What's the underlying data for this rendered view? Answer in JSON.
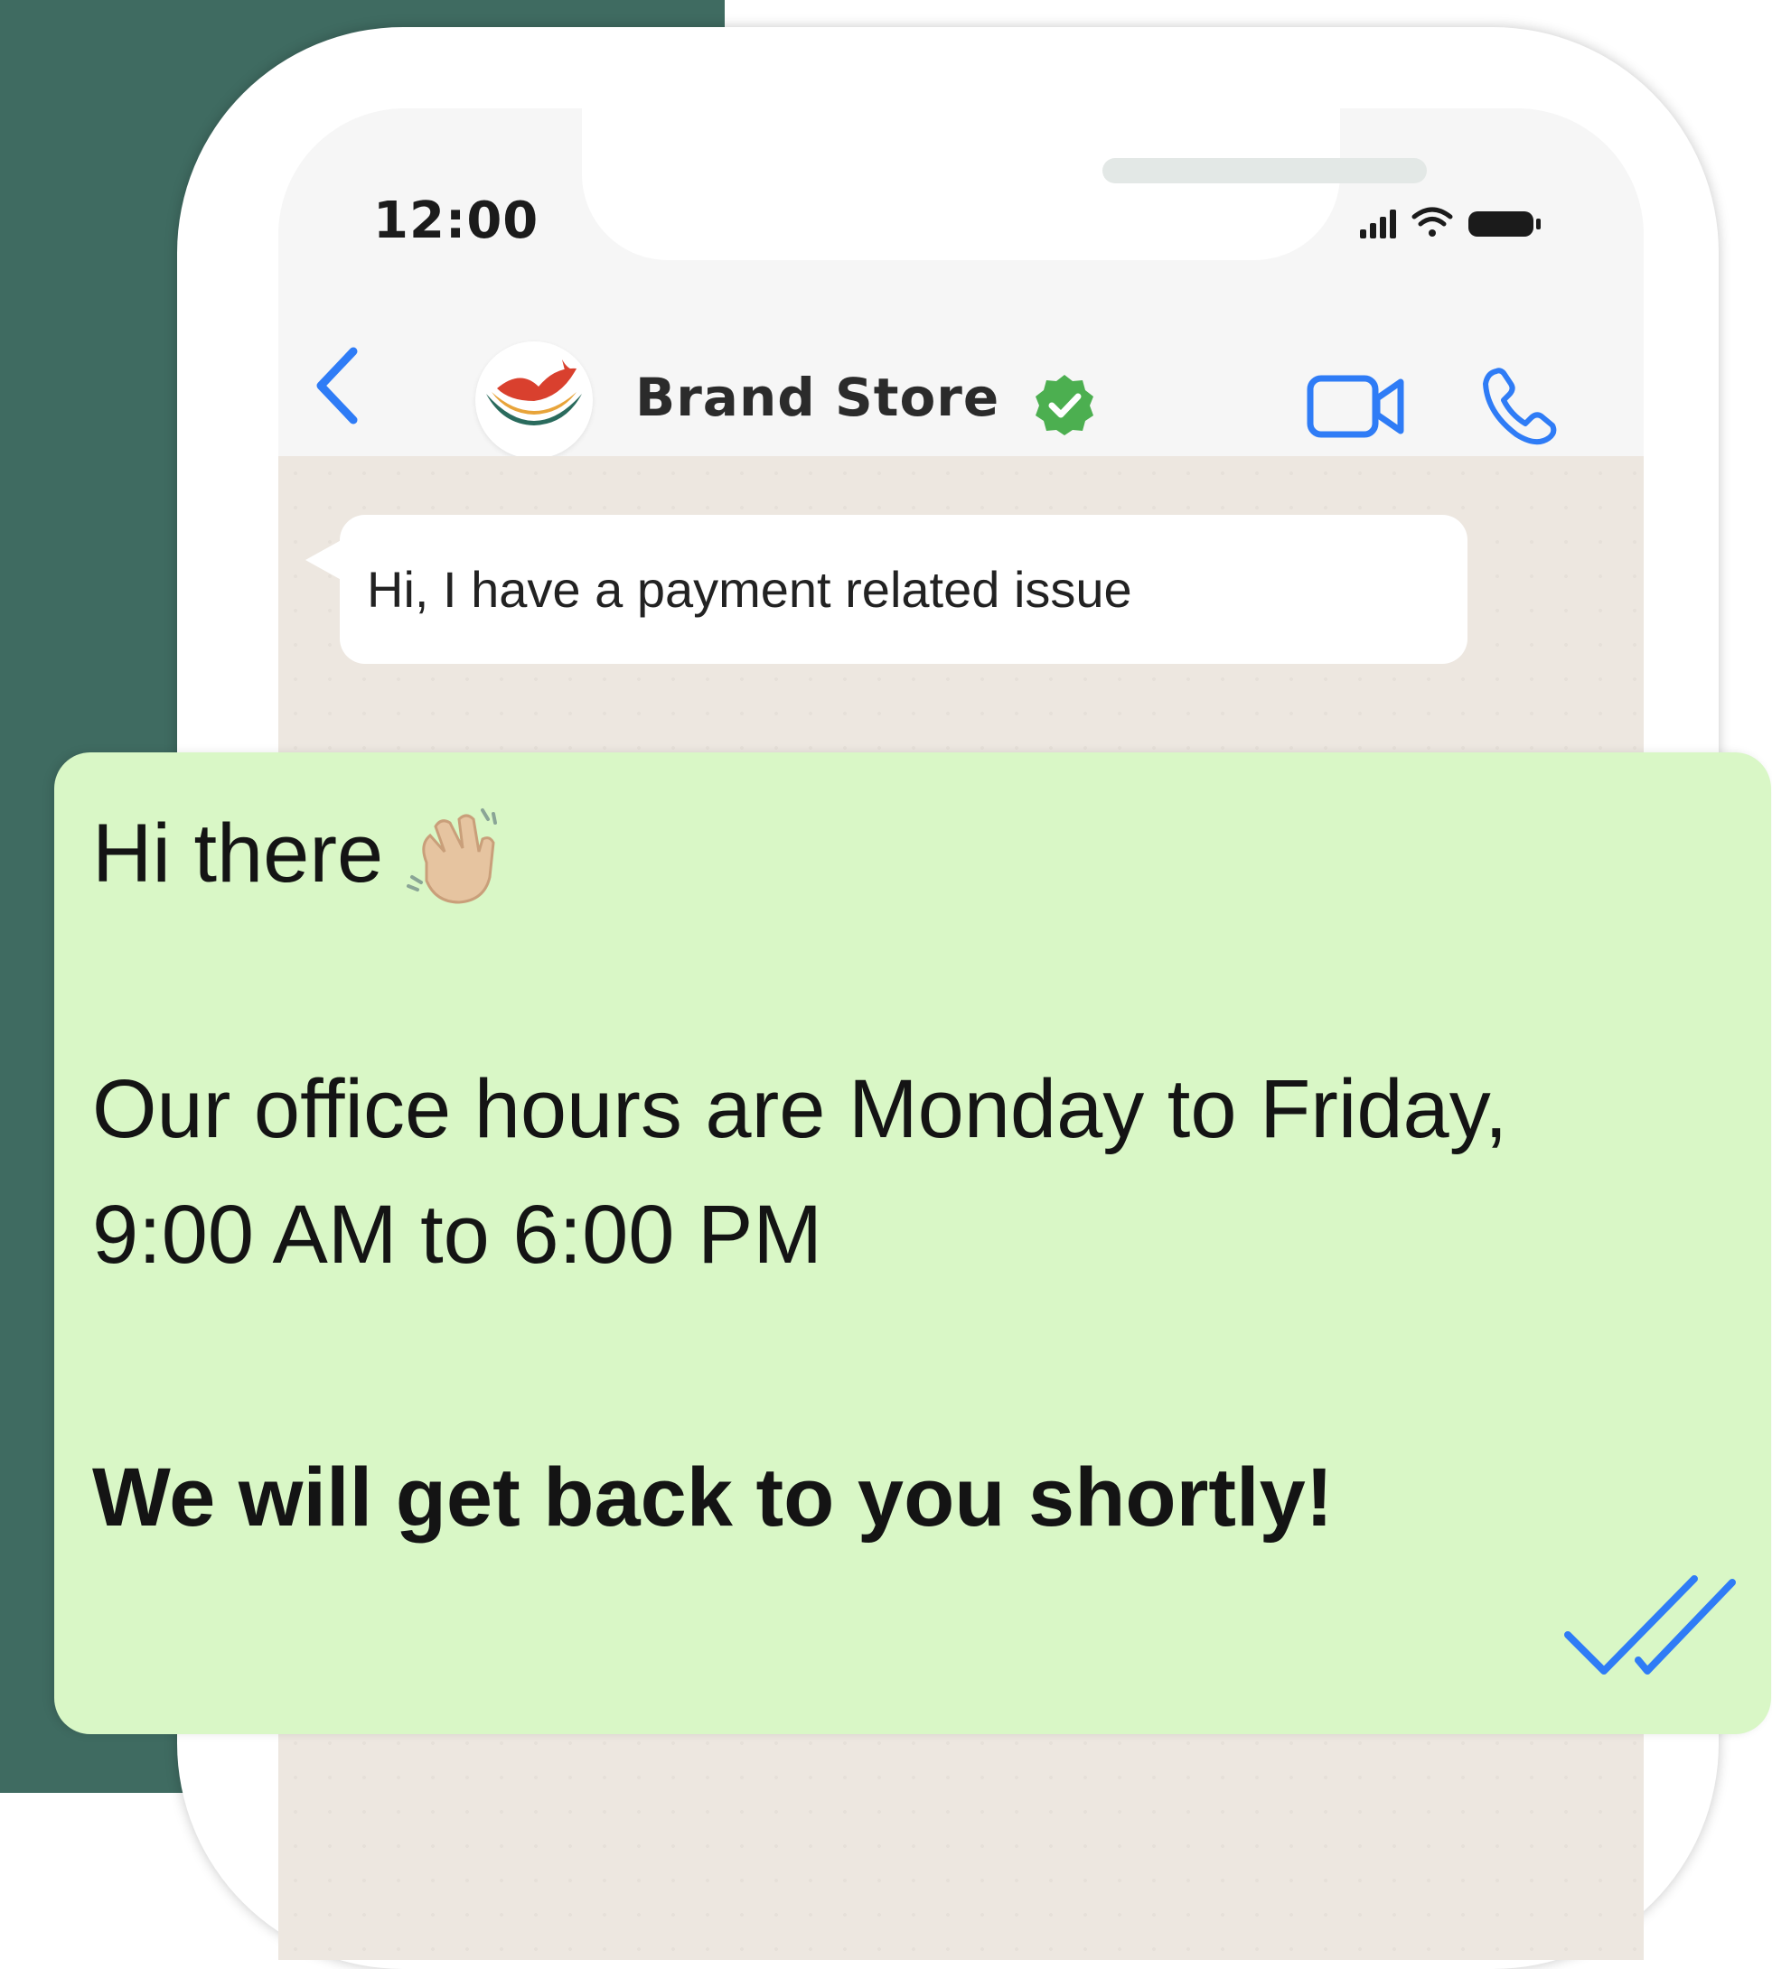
{
  "status_bar": {
    "time": "12:00",
    "icons": [
      "signal-icon",
      "wifi-icon",
      "battery-icon"
    ]
  },
  "header": {
    "contact_name": "Brand Store",
    "verified_icon": "verified-badge-icon",
    "actions": [
      "video-call-icon",
      "phone-call-icon"
    ],
    "accent_color": "#2f7cf6"
  },
  "messages": {
    "incoming": "Hi, I have a payment related issue",
    "outgoing": {
      "greeting": "Hi there",
      "hours_line1": "Our office hours are Monday to Friday,",
      "hours_line2": "9:00 AM to 6:00 PM",
      "closing": "We will get back to you shortly!"
    }
  },
  "colors": {
    "background_dark": "#3f6b61",
    "outgoing_bubble": "#d9f7c6",
    "chat_background": "#ede7e0",
    "verified_green": "#4caf50"
  }
}
